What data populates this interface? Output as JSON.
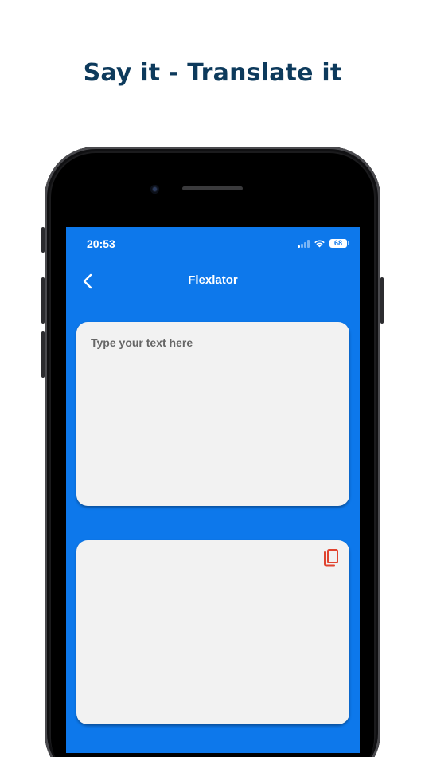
{
  "headline": "Say it - Translate it",
  "status_bar": {
    "time": "20:53",
    "battery_level": "68",
    "icons": [
      "cellular-signal-icon",
      "wifi-icon",
      "battery-icon"
    ]
  },
  "nav": {
    "back_icon": "chevron-left-icon",
    "title": "Flexlator"
  },
  "input_card": {
    "placeholder": "Type your text here",
    "value": ""
  },
  "output_card": {
    "text": "",
    "copy_icon": "copy-icon"
  },
  "colors": {
    "headline": "#0d3a5c",
    "screen_background": "#0d78eb",
    "card_background": "#f2f2f2",
    "copy_icon": "#e0432f"
  }
}
